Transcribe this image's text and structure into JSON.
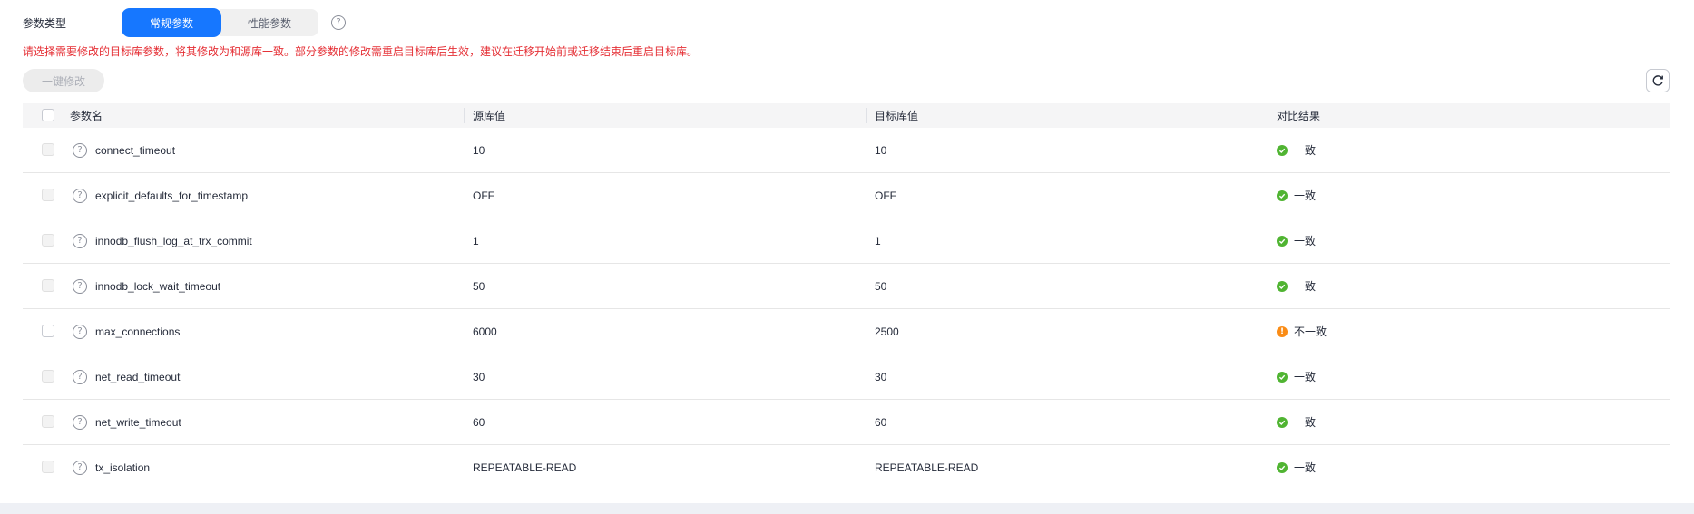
{
  "param_type": {
    "label": "参数类型",
    "tabs": [
      "常规参数",
      "性能参数"
    ],
    "active_tab": 0
  },
  "notice": "请选择需要修改的目标库参数，将其修改为和源库一致。部分参数的修改需重启目标库后生效，建议在迁移开始前或迁移结束后重启目标库。",
  "batch_modify_label": "一键修改",
  "table": {
    "headers": {
      "name": "参数名",
      "source": "源库值",
      "target": "目标库值",
      "result": "对比结果"
    },
    "rows": [
      {
        "name": "connect_timeout",
        "source": "10",
        "target": "10",
        "result": "一致",
        "status": "ok",
        "selectable": false
      },
      {
        "name": "explicit_defaults_for_timestamp",
        "source": "OFF",
        "target": "OFF",
        "result": "一致",
        "status": "ok",
        "selectable": false
      },
      {
        "name": "innodb_flush_log_at_trx_commit",
        "source": "1",
        "target": "1",
        "result": "一致",
        "status": "ok",
        "selectable": false
      },
      {
        "name": "innodb_lock_wait_timeout",
        "source": "50",
        "target": "50",
        "result": "一致",
        "status": "ok",
        "selectable": false
      },
      {
        "name": "max_connections",
        "source": "6000",
        "target": "2500",
        "result": "不一致",
        "status": "warn",
        "selectable": true
      },
      {
        "name": "net_read_timeout",
        "source": "30",
        "target": "30",
        "result": "一致",
        "status": "ok",
        "selectable": false
      },
      {
        "name": "net_write_timeout",
        "source": "60",
        "target": "60",
        "result": "一致",
        "status": "ok",
        "selectable": false
      },
      {
        "name": "tx_isolation",
        "source": "REPEATABLE-READ",
        "target": "REPEATABLE-READ",
        "result": "一致",
        "status": "ok",
        "selectable": false
      }
    ]
  },
  "colors": {
    "accent": "#1677ff",
    "notice": "#e52f35",
    "ok": "#50b432",
    "warn": "#fa8c16"
  },
  "icons": {
    "help": "question-circle-icon",
    "refresh": "refresh-icon",
    "ok": "check-circle-icon",
    "warn": "exclamation-circle-icon"
  }
}
